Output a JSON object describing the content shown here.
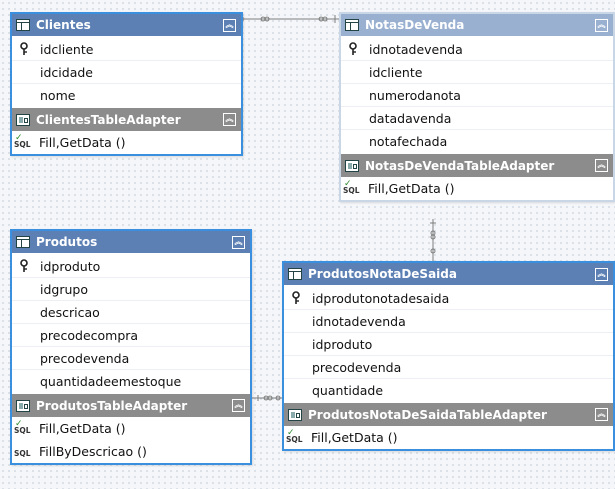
{
  "tables": {
    "clientes": {
      "name": "Clientes",
      "columns": [
        {
          "name": "idcliente",
          "key": true
        },
        {
          "name": "idcidade",
          "key": false
        },
        {
          "name": "nome",
          "key": false
        }
      ],
      "adapter": {
        "name": "ClientesTableAdapter",
        "queries": [
          "Fill,GetData ()"
        ]
      }
    },
    "notas": {
      "name": "NotasDeVenda",
      "columns": [
        {
          "name": "idnotadevenda",
          "key": true
        },
        {
          "name": "idcliente",
          "key": false
        },
        {
          "name": "numerodanota",
          "key": false
        },
        {
          "name": "datadavenda",
          "key": false
        },
        {
          "name": "notafechada",
          "key": false
        }
      ],
      "adapter": {
        "name": "NotasDeVendaTableAdapter",
        "queries": [
          "Fill,GetData ()"
        ]
      }
    },
    "produtos": {
      "name": "Produtos",
      "columns": [
        {
          "name": "idproduto",
          "key": true
        },
        {
          "name": "idgrupo",
          "key": false
        },
        {
          "name": "descricao",
          "key": false
        },
        {
          "name": "precodecompra",
          "key": false
        },
        {
          "name": "precodevenda",
          "key": false
        },
        {
          "name": "quantidadeemestoque",
          "key": false
        }
      ],
      "adapter": {
        "name": "ProdutosTableAdapter",
        "queries": [
          "Fill,GetData ()",
          "FillByDescricao ()"
        ]
      }
    },
    "produtosnota": {
      "name": "ProdutosNotaDeSaida",
      "columns": [
        {
          "name": "idprodutonotadesaida",
          "key": true
        },
        {
          "name": "idnotadevenda",
          "key": false
        },
        {
          "name": "idproduto",
          "key": false
        },
        {
          "name": "precodevenda",
          "key": false
        },
        {
          "name": "quantidade",
          "key": false
        }
      ],
      "adapter": {
        "name": "ProdutosNotaDeSaidaTableAdapter",
        "queries": [
          "Fill,GetData ()"
        ]
      }
    }
  },
  "icons": {
    "table": "table-icon",
    "adapter": "table-adapter-icon",
    "key": "primary-key-icon",
    "query": "sql-query-icon",
    "collapse": "collapse-chevron-icon"
  },
  "labels": {
    "sql": "SQL",
    "collapse_glyph": "︽"
  },
  "colors": {
    "selected_border": "#3b8fdf",
    "table_header": "#5c80b4",
    "dim_header": "#99b0d0",
    "adapter_header": "#8c8c8c"
  }
}
